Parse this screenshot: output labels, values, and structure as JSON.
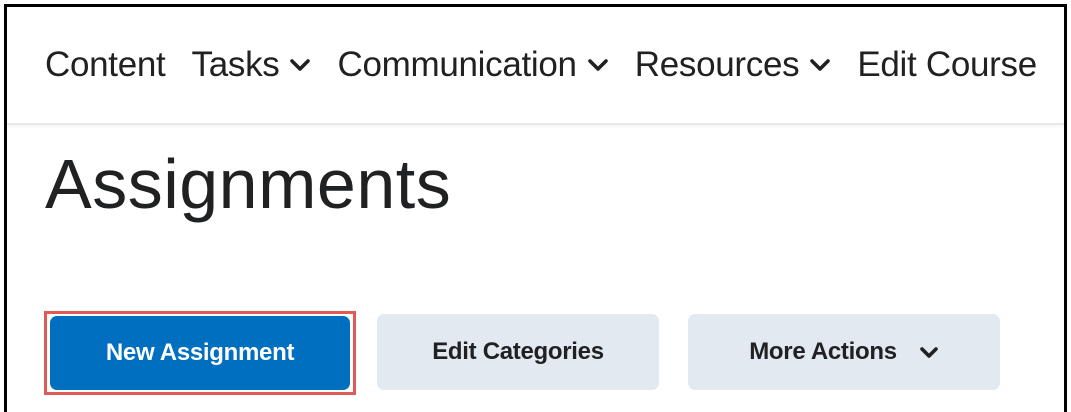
{
  "nav": {
    "items": [
      {
        "label": "Content",
        "has_dropdown": false
      },
      {
        "label": "Tasks",
        "has_dropdown": true
      },
      {
        "label": "Communication",
        "has_dropdown": true
      },
      {
        "label": "Resources",
        "has_dropdown": true
      },
      {
        "label": "Edit Course",
        "has_dropdown": false
      }
    ],
    "chevron_icon": "chevron-down-icon"
  },
  "page": {
    "title": "Assignments"
  },
  "actions": {
    "new_assignment_label": "New Assignment",
    "edit_categories_label": "Edit Categories",
    "more_actions_label": "More Actions",
    "more_actions_icon": "chevron-down-icon"
  },
  "colors": {
    "primary_button": "#006fbf",
    "secondary_button": "#e3e9f1",
    "highlight_outline": "#e05a5a",
    "text": "#202122"
  }
}
